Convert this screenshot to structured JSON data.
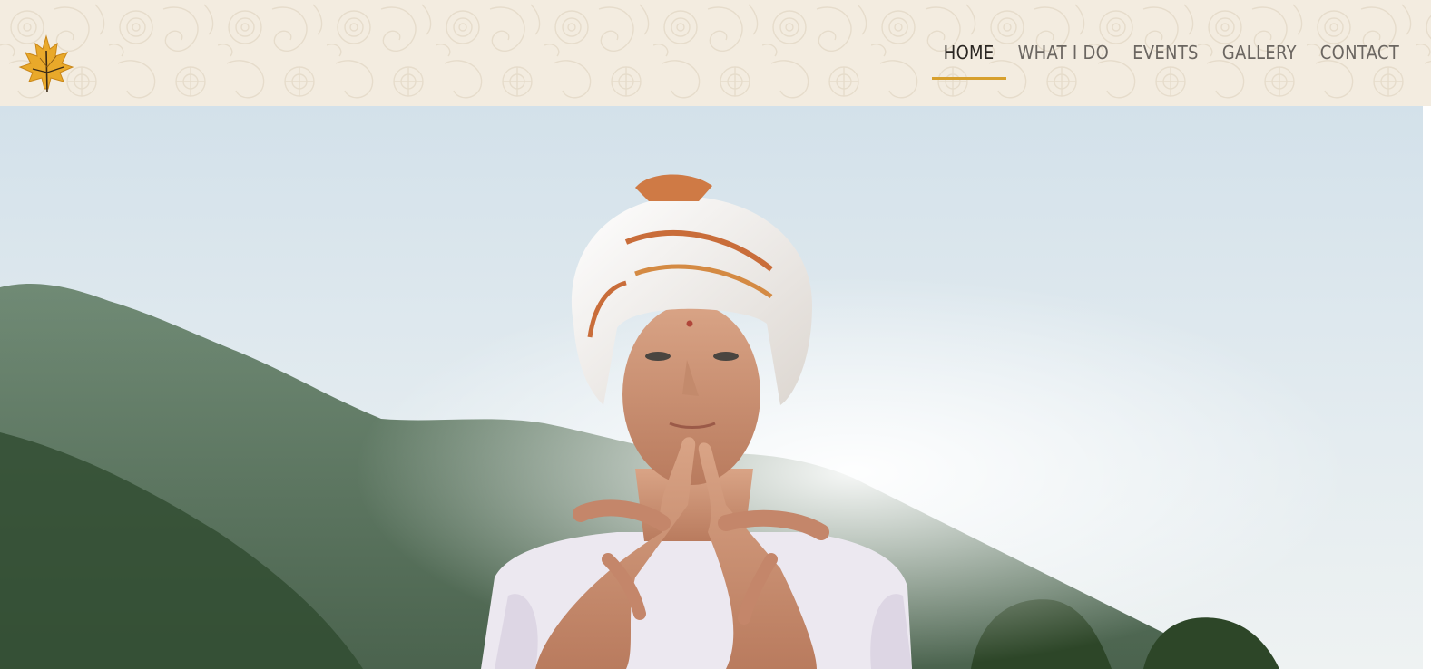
{
  "header": {
    "logo_icon": "maple-leaf-icon",
    "logo_color": "#e9a92a",
    "background_color": "#f3ece0"
  },
  "nav": {
    "accent_color": "#d7a02e",
    "items": [
      {
        "label": "HOME",
        "active": true
      },
      {
        "label": "WHAT I DO",
        "active": false
      },
      {
        "label": "EVENTS",
        "active": false
      },
      {
        "label": "GALLERY",
        "active": false
      },
      {
        "label": "CONTACT",
        "active": false
      }
    ]
  },
  "hero": {
    "image_subject": "woman-in-white-turban-mudra-photo",
    "sky_color": "#dde8ef",
    "hills_color": "#3f5a41"
  }
}
